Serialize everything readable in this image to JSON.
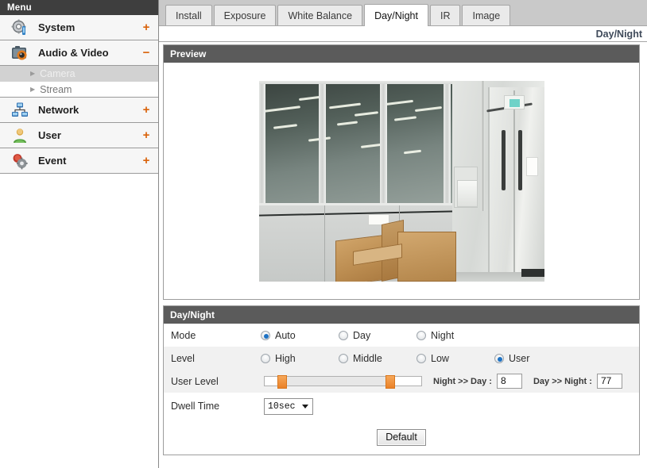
{
  "sidebar": {
    "header": "Menu",
    "items": [
      {
        "label": "System",
        "icon": "system-gear-icon",
        "toggle": "+",
        "expanded": false
      },
      {
        "label": "Audio & Video",
        "icon": "camera-icon",
        "toggle": "−",
        "expanded": true
      },
      {
        "label": "Network",
        "icon": "network-icon",
        "toggle": "+",
        "expanded": false
      },
      {
        "label": "User",
        "icon": "user-icon",
        "toggle": "+",
        "expanded": false
      },
      {
        "label": "Event",
        "icon": "event-icon",
        "toggle": "+",
        "expanded": false
      }
    ],
    "submenu": [
      {
        "label": "Camera",
        "active": true
      },
      {
        "label": "Stream",
        "active": false
      }
    ]
  },
  "tabs": [
    {
      "label": "Install",
      "active": false
    },
    {
      "label": "Exposure",
      "active": false
    },
    {
      "label": "White Balance",
      "active": false
    },
    {
      "label": "Day/Night",
      "active": true
    },
    {
      "label": "IR",
      "active": false
    },
    {
      "label": "Image",
      "active": false
    }
  ],
  "breadcrumb": "Day/Night",
  "preview": {
    "title": "Preview",
    "description": "live camera view of office corridor with glass partition wall, double door and cardboard boxes"
  },
  "settings": {
    "title": "Day/Night",
    "rows": {
      "mode": {
        "label": "Mode",
        "options": [
          {
            "label": "Auto",
            "checked": true
          },
          {
            "label": "Day",
            "checked": false
          },
          {
            "label": "Night",
            "checked": false
          }
        ]
      },
      "level": {
        "label": "Level",
        "options": [
          {
            "label": "High",
            "checked": false
          },
          {
            "label": "Middle",
            "checked": false
          },
          {
            "label": "Low",
            "checked": false
          },
          {
            "label": "User",
            "checked": true
          }
        ]
      },
      "user_level": {
        "label": "User Level",
        "night_to_day_label": "Night >> Day :",
        "night_to_day_value": "8",
        "day_to_night_label": "Day >> Night :",
        "day_to_night_value": "77",
        "slider_min_percent": 8,
        "slider_max_percent": 77
      },
      "dwell_time": {
        "label": "Dwell Time",
        "value": "10sec"
      }
    },
    "default_button": "Default"
  },
  "colors": {
    "accent_orange": "#d9620a",
    "header_dark": "#3e3e3e",
    "panel_header": "#5b5b5b",
    "radio_blue": "#1d72c4",
    "slider_orange": "#ea8128"
  }
}
